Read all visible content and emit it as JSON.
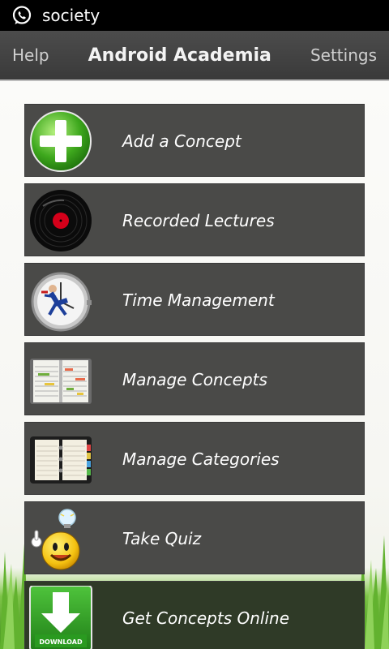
{
  "status_bar": {
    "app_icon": "whatsapp-icon",
    "text": "society"
  },
  "action_bar": {
    "left": "Help",
    "title": "Android Academia",
    "right": "Settings"
  },
  "menu": [
    {
      "label": "Add a Concept",
      "icon": "green-plus-icon"
    },
    {
      "label": "Recorded Lectures",
      "icon": "vinyl-record-icon"
    },
    {
      "label": "Time Management",
      "icon": "stopwatch-runner-icon"
    },
    {
      "label": "Manage Concepts",
      "icon": "open-organizer-icon"
    },
    {
      "label": "Manage Categories",
      "icon": "notebook-icon"
    },
    {
      "label": "Take Quiz",
      "icon": "smiley-lightbulb-icon"
    },
    {
      "label": "Get Concepts Online",
      "icon": "download-icon",
      "icon_text": "DOWNLOAD"
    }
  ],
  "colors": {
    "bar": "#3f3f3f",
    "button": "#4a4a48",
    "grass": "#5fae2a"
  }
}
